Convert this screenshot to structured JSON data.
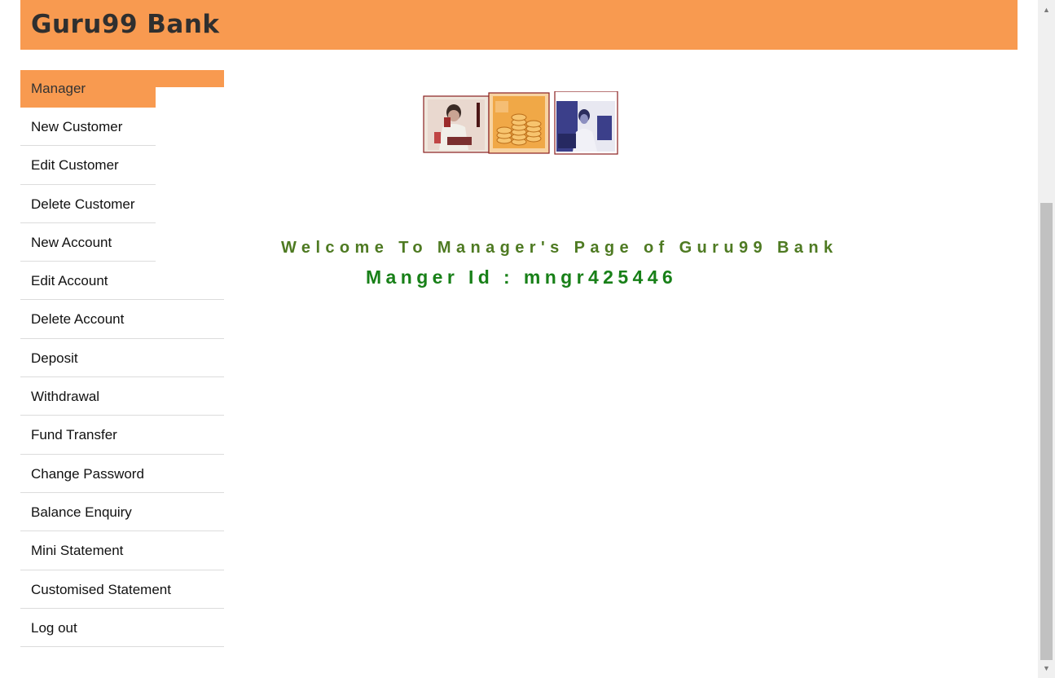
{
  "header": {
    "brand": "Guru99 Bank"
  },
  "menu": {
    "heading": "Manager",
    "items": [
      {
        "label": "New Customer"
      },
      {
        "label": "Edit Customer"
      },
      {
        "label": "Delete Customer"
      },
      {
        "label": "New Account"
      },
      {
        "label": "Edit Account"
      },
      {
        "label": "Delete Account"
      },
      {
        "label": "Deposit"
      },
      {
        "label": "Withdrawal"
      },
      {
        "label": "Fund Transfer"
      },
      {
        "label": "Change Password"
      },
      {
        "label": "Balance Enquiry"
      },
      {
        "label": "Mini Statement"
      },
      {
        "label": "Customised Statement"
      },
      {
        "label": "Log out"
      }
    ]
  },
  "main": {
    "welcome": "Welcome To Manager's Page of Guru99 Bank",
    "manager_id": "Manger Id : mngr425446"
  },
  "colors": {
    "accent": "#f89a50",
    "welcome_text": "#4e7a22",
    "manager_id_text": "#188018"
  },
  "icons": {
    "scroll_up": "scroll-up-arrow-icon",
    "scroll_down": "scroll-down-arrow-icon"
  }
}
